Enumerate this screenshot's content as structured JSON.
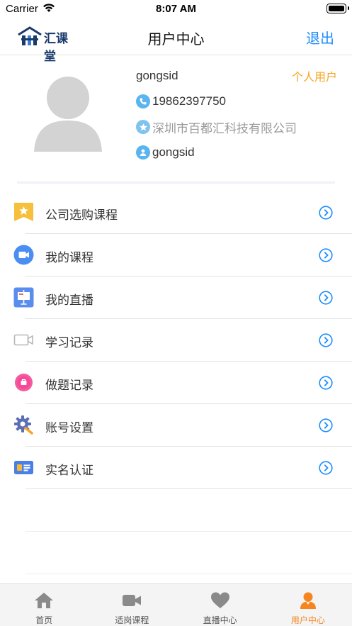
{
  "status_bar": {
    "carrier": "Carrier",
    "time": "8:07 AM"
  },
  "nav": {
    "logo_text": "汇课堂",
    "title": "用户中心",
    "logout": "退出"
  },
  "profile": {
    "username": "gongsid",
    "user_type": "个人用户",
    "phone": "19862397750",
    "company": "深圳市百都汇科技有限公司",
    "account": "gongsid"
  },
  "menu": [
    {
      "label": "公司选购课程",
      "icon": "star-badge-icon"
    },
    {
      "label": "我的课程",
      "icon": "video-icon"
    },
    {
      "label": "我的直播",
      "icon": "presentation-board-icon"
    },
    {
      "label": "学习记录",
      "icon": "camera-record-icon"
    },
    {
      "label": "做题记录",
      "icon": "exercise-icon"
    },
    {
      "label": "账号设置",
      "icon": "gear-icon"
    },
    {
      "label": "实名认证",
      "icon": "id-card-icon"
    }
  ],
  "tabs": [
    {
      "label": "首页",
      "icon": "home-icon",
      "active": false
    },
    {
      "label": "适岗课程",
      "icon": "video-camera-icon",
      "active": false
    },
    {
      "label": "直播中心",
      "icon": "heart-icon",
      "active": false
    },
    {
      "label": "用户中心",
      "icon": "user-icon",
      "active": true
    }
  ],
  "colors": {
    "accent": "#1a8cff",
    "user_type": "#f5a623",
    "tab_active": "#f5861f",
    "info_icon": "#5ab4f0"
  }
}
